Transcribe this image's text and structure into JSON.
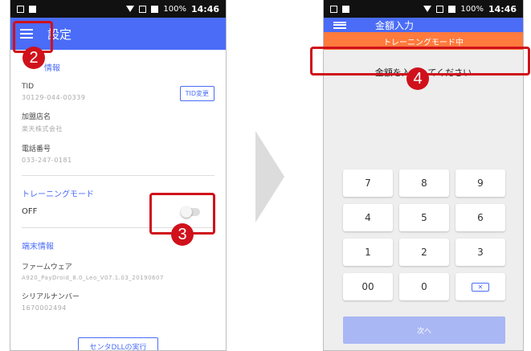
{
  "left_screen": {
    "status_time": "14:46",
    "status_battery": "100%",
    "title": "設定",
    "section_store_partial": "情報",
    "tid_label": "TID",
    "tid_value": "30129-044-00339",
    "tid_change_button": "TID変更",
    "store_name_label": "加盟店名",
    "store_name_value": "楽天株式会社",
    "phone_label": "電話番号",
    "phone_value": "033-247-0181",
    "training_section": "トレーニングモード",
    "training_state": "OFF",
    "terminal_section": "端末情報",
    "firmware_label": "ファームウェア",
    "firmware_value": "A920_PayDroid_8.0_Leo_V07.1.03_20190607",
    "serial_label": "シリアルナンバー",
    "serial_value": "1670002494",
    "center_button": "センタDLLの実行"
  },
  "right_screen": {
    "status_time": "14:46",
    "status_battery": "100%",
    "title": "金額入力",
    "training_banner": "トレーニングモード中",
    "prompt": "金額を入力してください",
    "keys": [
      "7",
      "8",
      "9",
      "4",
      "5",
      "6",
      "1",
      "2",
      "3",
      "00",
      "0"
    ],
    "backspace_symbol": "✕",
    "next_button": "次へ"
  },
  "callouts": {
    "c2": "2",
    "c3": "3",
    "c4": "4"
  },
  "colors": {
    "accent": "#4a6cf7",
    "callout": "#d0111b",
    "training_banner": "#ff7a3d"
  }
}
